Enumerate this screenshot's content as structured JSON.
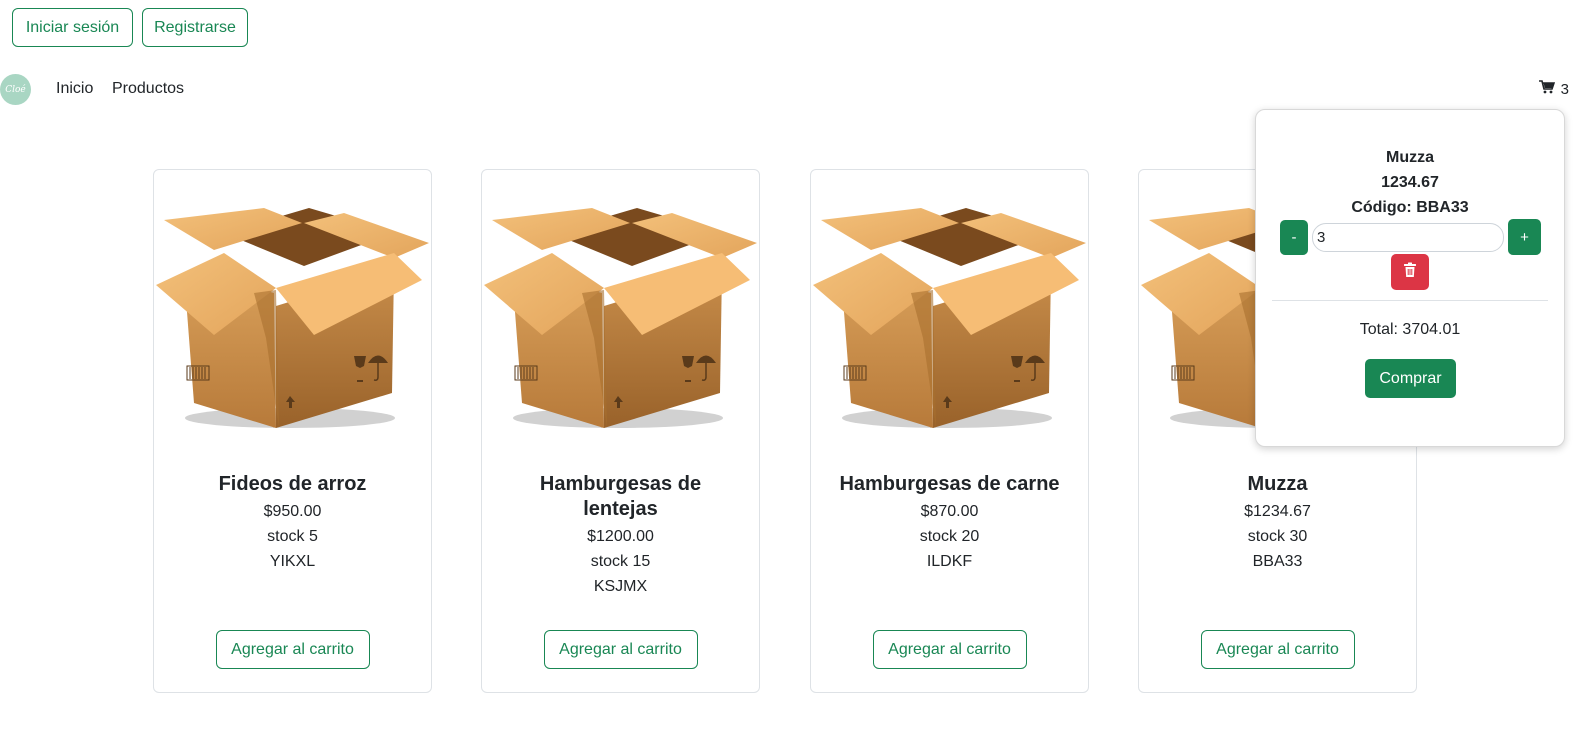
{
  "auth": {
    "login_label": "Iniciar sesión",
    "register_label": "Registrarse"
  },
  "nav": {
    "logo_text": "Cloé",
    "links": [
      "Inicio",
      "Productos"
    ],
    "cart_count": "3"
  },
  "products": [
    {
      "name": "Fideos de arroz",
      "price": "$950.00",
      "stock": "stock 5",
      "code": "YIKXL"
    },
    {
      "name": "Hamburgesas de lentejas",
      "price": "$1200.00",
      "stock": "stock 15",
      "code": "KSJMX"
    },
    {
      "name": "Hamburgesas de carne",
      "price": "$870.00",
      "stock": "stock 20",
      "code": "ILDKF"
    },
    {
      "name": "Muzza",
      "price": "$1234.67",
      "stock": "stock 30",
      "code": "BBA33"
    }
  ],
  "add_to_cart_label": "Agregar al carrito",
  "cart": {
    "item_name": "Muzza",
    "item_price": "1234.67",
    "item_code": "Código: BBA33",
    "decrement_label": "-",
    "increment_label": "+",
    "quantity": "3",
    "total": "Total: 3704.01",
    "buy_label": "Comprar"
  },
  "colors": {
    "primary_green": "#198754",
    "danger_red": "#dc3545",
    "logo_bg": "#a9d6c3"
  }
}
